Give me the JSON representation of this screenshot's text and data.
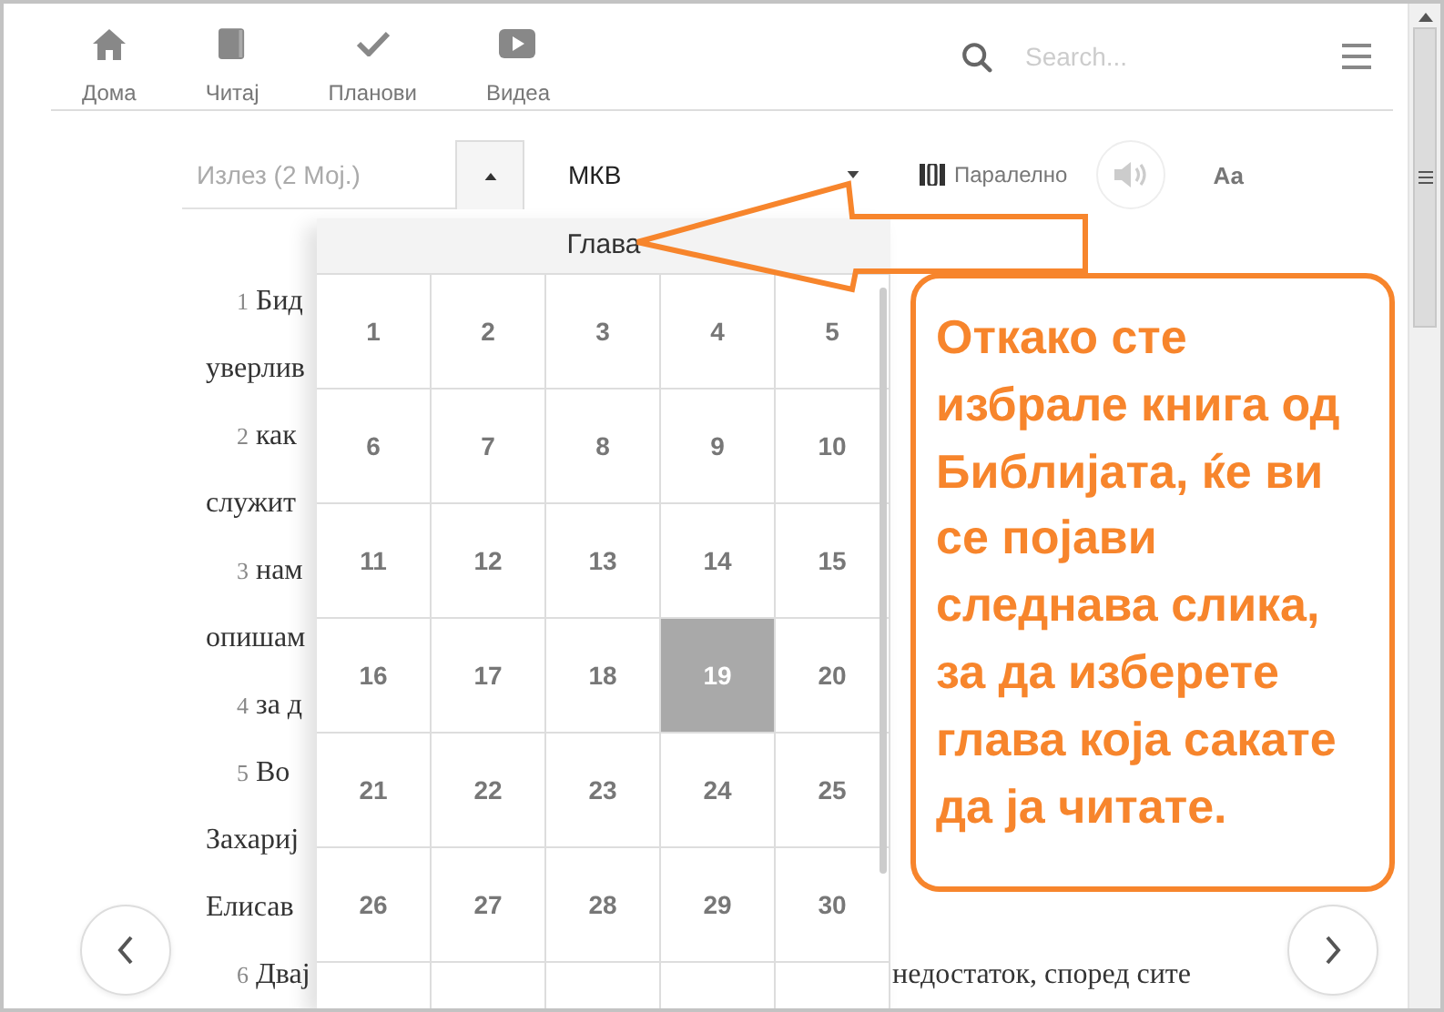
{
  "nav": {
    "items": [
      {
        "label": "Дома",
        "kind": "home"
      },
      {
        "label": "Читај",
        "kind": "book"
      },
      {
        "label": "Планови",
        "kind": "check"
      },
      {
        "label": "Видеа",
        "kind": "video"
      }
    ]
  },
  "search": {
    "placeholder": "Search..."
  },
  "toolbar": {
    "reference_placeholder": "Излез (2 Мој.)",
    "version": "МКВ",
    "parallel": "Паралелно",
    "font_button": "Аа"
  },
  "passage": [
    {
      "verse": "1",
      "text": "Бид"
    },
    {
      "text": "уверлив"
    },
    {
      "verse": "2",
      "text": "как"
    },
    {
      "text": "служит"
    },
    {
      "verse": "3",
      "text": "нам"
    },
    {
      "text": "опишам"
    },
    {
      "verse": "4",
      "text": "за д"
    },
    {
      "verse": "5",
      "text": "Во"
    },
    {
      "text": "Захариј"
    },
    {
      "text": "Елисав"
    },
    {
      "verse": "6",
      "text": "Двај",
      "right_text": "недостаток, според сите"
    }
  ],
  "chapter_picker": {
    "title": "Глава",
    "chapters": [
      {
        "label": "1",
        "selected": false
      },
      {
        "label": "2",
        "selected": false
      },
      {
        "label": "3",
        "selected": false
      },
      {
        "label": "4",
        "selected": false
      },
      {
        "label": "5",
        "selected": false
      },
      {
        "label": "6",
        "selected": false
      },
      {
        "label": "7",
        "selected": false
      },
      {
        "label": "8",
        "selected": false
      },
      {
        "label": "9",
        "selected": false
      },
      {
        "label": "10",
        "selected": false
      },
      {
        "label": "11",
        "selected": false
      },
      {
        "label": "12",
        "selected": false
      },
      {
        "label": "13",
        "selected": false
      },
      {
        "label": "14",
        "selected": false
      },
      {
        "label": "15",
        "selected": false
      },
      {
        "label": "16",
        "selected": false
      },
      {
        "label": "17",
        "selected": false
      },
      {
        "label": "18",
        "selected": false
      },
      {
        "label": "19",
        "selected": true
      },
      {
        "label": "20",
        "selected": false
      },
      {
        "label": "21",
        "selected": false
      },
      {
        "label": "22",
        "selected": false
      },
      {
        "label": "23",
        "selected": false
      },
      {
        "label": "24",
        "selected": false
      },
      {
        "label": "25",
        "selected": false
      },
      {
        "label": "26",
        "selected": false
      },
      {
        "label": "27",
        "selected": false
      },
      {
        "label": "28",
        "selected": false
      },
      {
        "label": "29",
        "selected": false
      },
      {
        "label": "30",
        "selected": false
      }
    ]
  },
  "callout": {
    "text": "Откако сте избрале книга од Библијата, ќе ви се појави следнава слика, за да изберете глава која сакате да ја читате."
  }
}
